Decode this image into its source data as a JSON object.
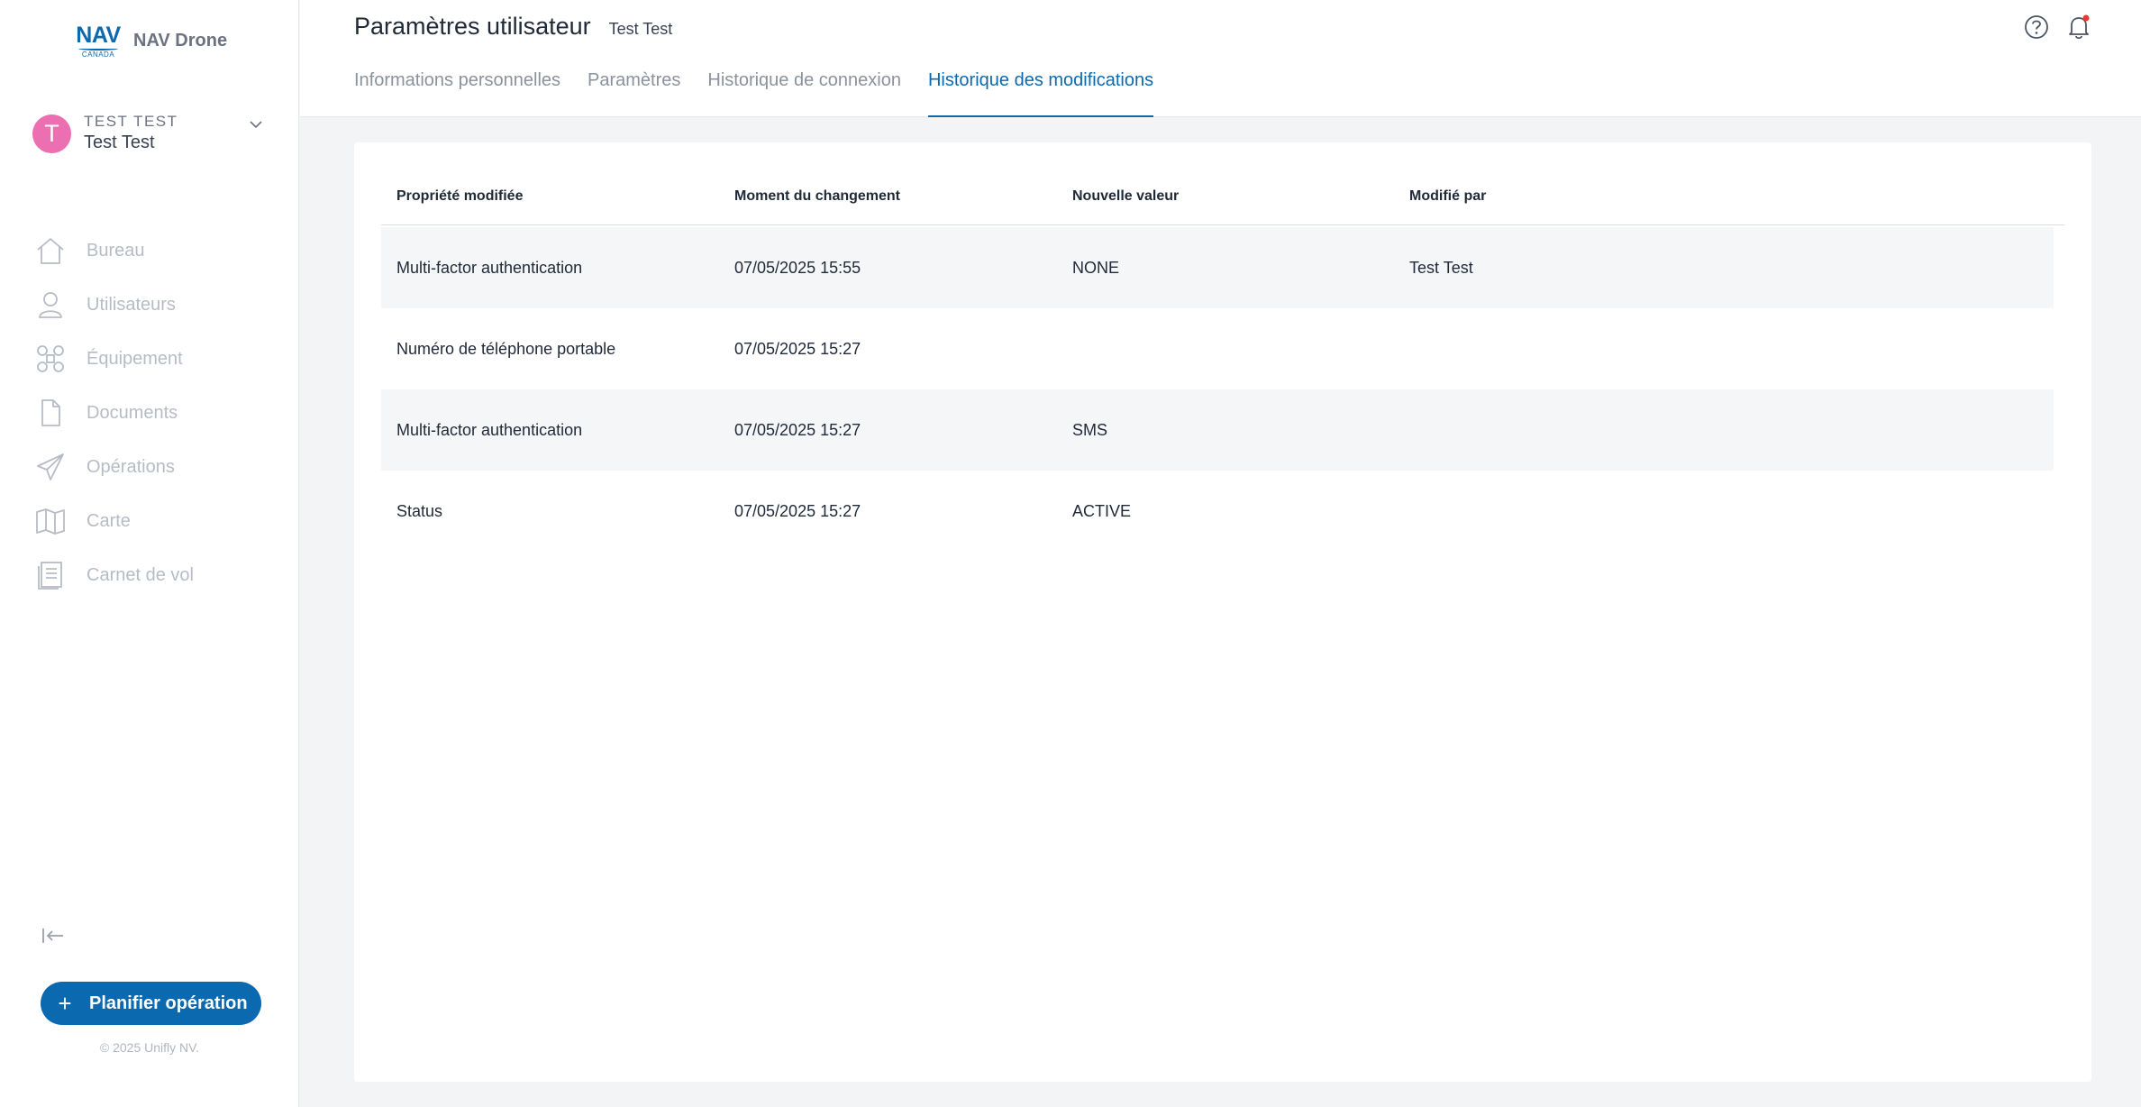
{
  "brand": {
    "logo_nav": "NAV",
    "logo_canada": "CANADA",
    "app_name": "NAV Drone"
  },
  "user": {
    "initial": "T",
    "upper_name": "TEST TEST",
    "name": "Test Test"
  },
  "nav": {
    "items": [
      {
        "label": "Bureau",
        "icon": "home-icon"
      },
      {
        "label": "Utilisateurs",
        "icon": "user-icon"
      },
      {
        "label": "Équipement",
        "icon": "drone-icon"
      },
      {
        "label": "Documents",
        "icon": "document-icon"
      },
      {
        "label": "Opérations",
        "icon": "paper-plane-icon"
      },
      {
        "label": "Carte",
        "icon": "map-icon"
      },
      {
        "label": "Carnet de vol",
        "icon": "logbook-icon"
      }
    ]
  },
  "sidebar_footer": {
    "plan_button": "Planifier opération",
    "plan_icon": "+",
    "copyright": "© 2025 Unifly NV."
  },
  "header": {
    "title": "Paramètres utilisateur",
    "subtitle": "Test Test",
    "tabs": [
      {
        "label": "Informations personnelles",
        "active": false
      },
      {
        "label": "Paramètres",
        "active": false
      },
      {
        "label": "Historique de connexion",
        "active": false
      },
      {
        "label": "Historique des modifications",
        "active": true
      }
    ]
  },
  "table": {
    "columns": [
      "Propriété modifiée",
      "Moment du changement",
      "Nouvelle valeur",
      "Modifié par"
    ],
    "rows": [
      [
        "Multi-factor authentication",
        "07/05/2025 15:55",
        "NONE",
        "Test Test"
      ],
      [
        "Numéro de téléphone portable",
        "07/05/2025 15:27",
        "",
        ""
      ],
      [
        "Multi-factor authentication",
        "07/05/2025 15:27",
        "SMS",
        ""
      ],
      [
        "Status",
        "07/05/2025 15:27",
        "ACTIVE",
        ""
      ]
    ]
  },
  "colors": {
    "accent": "#0b69b0",
    "avatar": "#ec6fb1",
    "notification_dot": "#e53935"
  }
}
